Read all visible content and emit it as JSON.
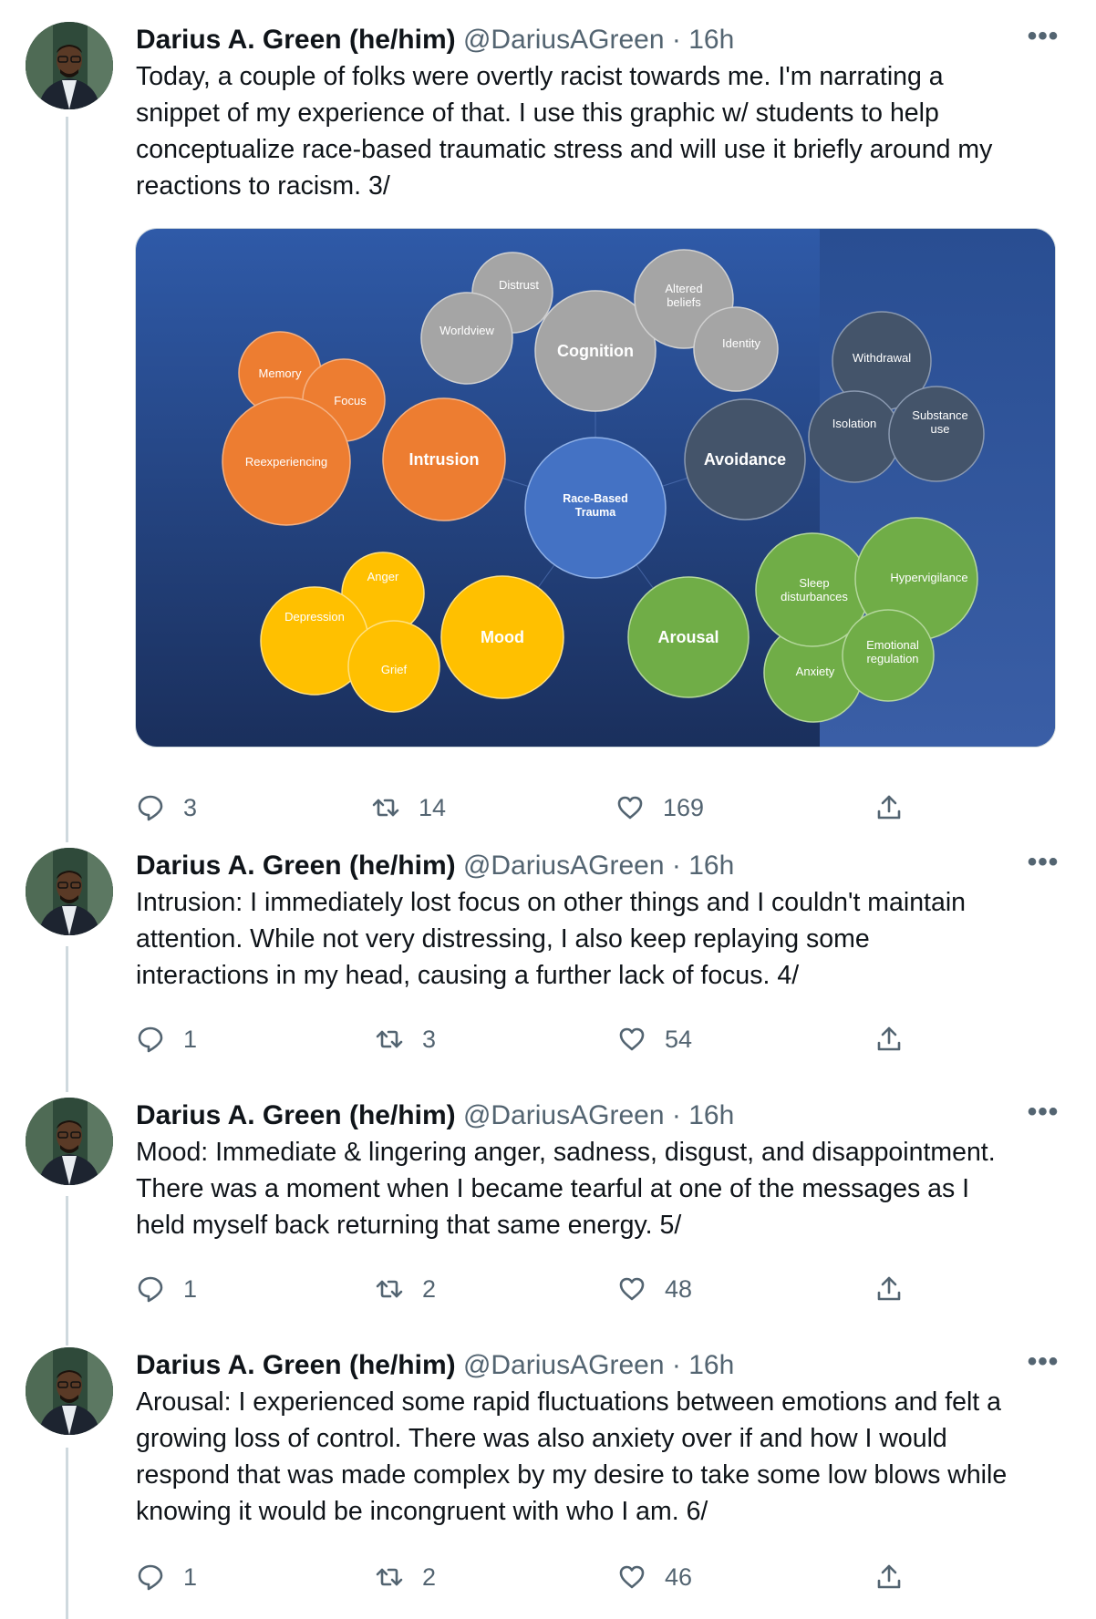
{
  "tweets": [
    {
      "name": "Darius A. Green (he/him)",
      "handle": "@DariusAGreen",
      "dot": "·",
      "time": "16h",
      "more": "•••",
      "lines": [
        "Today, a couple of folks were overtly racist towards me. I'm narrating a",
        "snippet of my experience of that. I use this graphic w/ students to help",
        "conceptualize race-based traumatic stress and will use it briefly around my",
        "reactions to racism. 3/"
      ],
      "replies": "3",
      "retweets": "14",
      "likes": "169"
    },
    {
      "name": "Darius A. Green (he/him)",
      "handle": "@DariusAGreen",
      "dot": "·",
      "time": "16h",
      "more": "•••",
      "lines": [
        "Intrusion: I immediately lost focus on other things and I couldn't maintain",
        "attention. While not very distressing, I also keep replaying some",
        "interactions in my head, causing a further lack of focus. 4/"
      ],
      "replies": "1",
      "retweets": "3",
      "likes": "54"
    },
    {
      "name": "Darius A. Green (he/him)",
      "handle": "@DariusAGreen",
      "dot": "·",
      "time": "16h",
      "more": "•••",
      "lines": [
        "Mood: Immediate & lingering anger, sadness, disgust, and disappointment.",
        "There was a moment when I became tearful at one of the messages as I",
        "held myself back returning that same energy. 5/"
      ],
      "replies": "1",
      "retweets": "2",
      "likes": "48"
    },
    {
      "name": "Darius A. Green (he/him)",
      "handle": "@DariusAGreen",
      "dot": "·",
      "time": "16h",
      "more": "•••",
      "lines": [
        "Arousal: I experienced some rapid fluctuations between emotions and felt a",
        "growing loss of control. There was also anxiety over if and how I would",
        "respond that was made complex by my desire to take some low blows while",
        "knowing it would be incongruent with who I am. 6/"
      ],
      "replies": "1",
      "retweets": "2",
      "likes": "46"
    }
  ],
  "graphic": {
    "center": [
      "Race-Based",
      "Trauma"
    ],
    "intrusion": "Intrusion",
    "memory": "Memory",
    "focus": "Focus",
    "reexperiencing": "Reexperiencing",
    "cognition": "Cognition",
    "distrust": "Distrust",
    "worldview": "Worldview",
    "altered_beliefs": [
      "Altered",
      "beliefs"
    ],
    "identity": "Identity",
    "avoidance": "Avoidance",
    "withdrawal": "Withdrawal",
    "isolation": "Isolation",
    "substance_use": [
      "Substance",
      "use"
    ],
    "mood": "Mood",
    "anger": "Anger",
    "depression": "Depression",
    "grief": "Grief",
    "arousal": "Arousal",
    "sleep_disturbances": [
      "Sleep",
      "disturbances"
    ],
    "hypervigilance": "Hypervigilance",
    "anxiety": "Anxiety",
    "emotional_regulation": [
      "Emotional",
      "regulation"
    ],
    "colors": {
      "background": "#2b4c8a",
      "intrusion": "#ed7d31",
      "cognition": "#a5a5a5",
      "avoidance": "#44546a",
      "mood": "#ffc000",
      "arousal": "#70ad47",
      "center": "#4472c4"
    }
  },
  "icons": {
    "reply": "reply-icon",
    "retweet": "retweet-icon",
    "like": "heart-icon",
    "share": "share-icon",
    "more": "more-icon"
  }
}
